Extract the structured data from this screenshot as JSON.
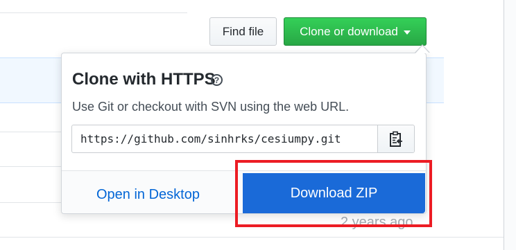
{
  "toolbar": {
    "find_file_label": "Find file",
    "clone_label": "Clone or download"
  },
  "clone_popover": {
    "title": "Clone with HTTPS",
    "help_icon": "question-circle-icon",
    "description": "Use Git or checkout with SVN using the web URL.",
    "url_value": "https://github.com/sinhrks/cesiumpy.git",
    "copy_icon": "clipboard-icon",
    "open_desktop_label": "Open in Desktop",
    "download_zip_label": "Download ZIP"
  },
  "file_list": {
    "time_ago": "2 years ago"
  },
  "colors": {
    "clone_button": "#28a745",
    "download_zip": "#1a6ad8",
    "link": "#0366d6",
    "highlight_box": "#ec1c24"
  }
}
